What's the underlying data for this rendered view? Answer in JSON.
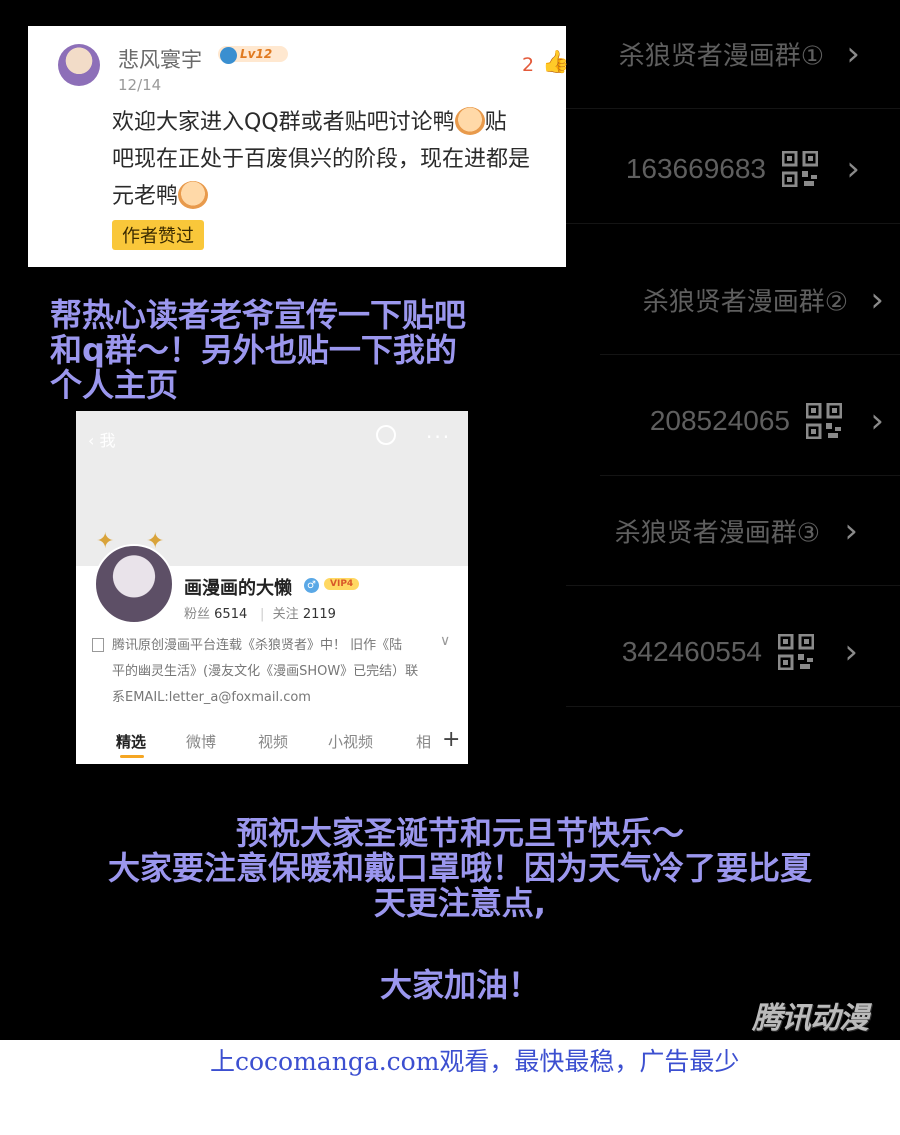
{
  "groups": [
    {
      "name": "杀狼贤者漫画群①",
      "number": "163669683"
    },
    {
      "name": "杀狼贤者漫画群②",
      "number": "208524065"
    },
    {
      "name": "杀狼贤者漫画群③",
      "number": "342460554"
    }
  ],
  "comment": {
    "username": "悲风寰宇",
    "level": "Lv12",
    "date": "12/14",
    "likes": "2",
    "text_line1": "欢迎大家进入QQ群或者贴吧讨论鸭",
    "text_line1b": "贴",
    "text_line2": "吧现在正处于百废俱兴的阶段，现在进都是",
    "text_line3": "元老鸭",
    "author_liked": "作者赞过"
  },
  "promo": {
    "line1": "帮热心读者老爷宣传一下贴吧",
    "line2": "和q群～！另外也贴一下我的",
    "line3": "个人主页"
  },
  "profile": {
    "back_label": "我",
    "name": "画漫画的大懒",
    "vip": "VIP4",
    "followers_label": "粉丝",
    "followers": "6514",
    "following_label": "关注",
    "following": "2119",
    "bio_line1": "腾讯原创漫画平台连载《杀狼贤者》中！ 旧作《陆",
    "bio_line2": "平的幽灵生活》(漫友文化《漫画SHOW》已完结）联",
    "bio_line3": "系EMAIL:letter_a@foxmail.com",
    "tabs": [
      "精选",
      "微博",
      "视频",
      "小视频",
      "相"
    ]
  },
  "greeting": {
    "line1": "预祝大家圣诞节和元旦节快乐～",
    "line2": "大家要注意保暖和戴口罩哦！因为天气冷了要比夏",
    "line3": "天更注意点,",
    "cheer": "大家加油！"
  },
  "watermark": "腾讯动漫",
  "footer": "上cocomanga.com观看，最快最稳，广告最少"
}
